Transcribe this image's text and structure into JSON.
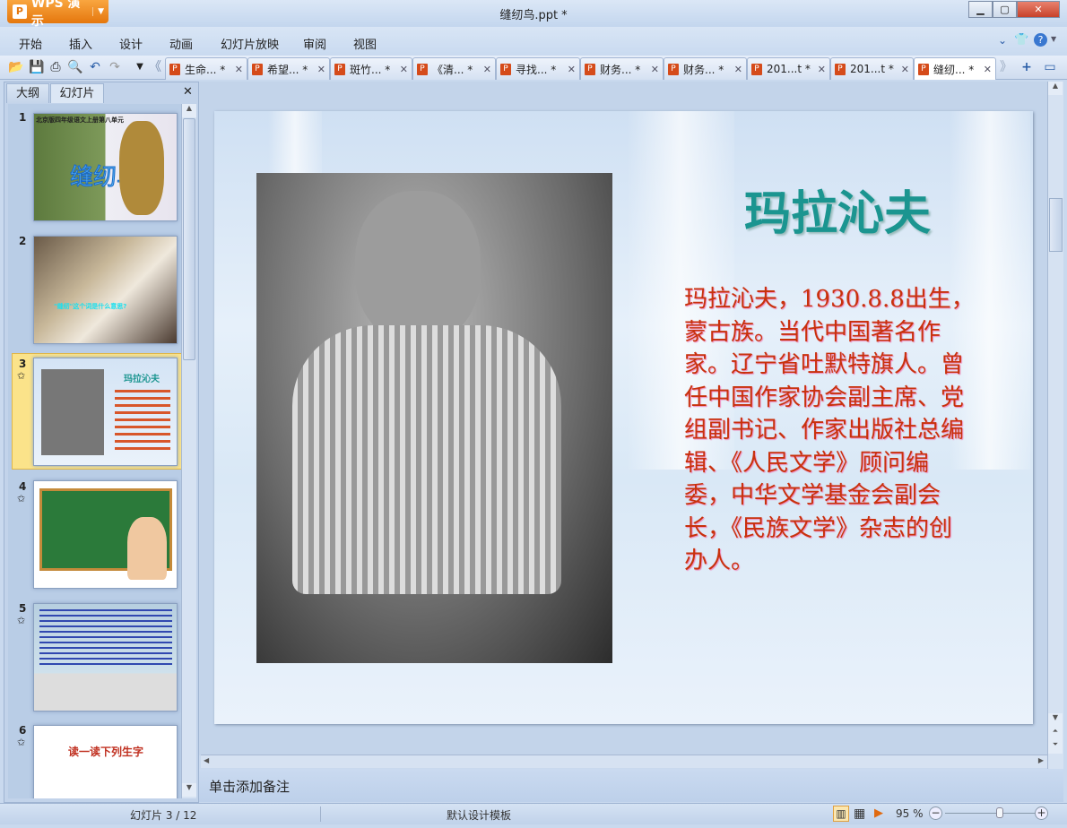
{
  "app": {
    "name": "WPS 演示",
    "document_title": "缝纫鸟.ppt *"
  },
  "menu": [
    "开始",
    "插入",
    "设计",
    "动画",
    "幻灯片放映",
    "审阅",
    "视图"
  ],
  "doc_tabs": [
    {
      "label": "生命... *",
      "active": false
    },
    {
      "label": "希望... *",
      "active": false
    },
    {
      "label": "斑竹... *",
      "active": false
    },
    {
      "label": "《清... *",
      "active": false
    },
    {
      "label": "寻找... *",
      "active": false
    },
    {
      "label": "财务... *",
      "active": false
    },
    {
      "label": "财务... *",
      "active": false
    },
    {
      "label": "201...t *",
      "active": false
    },
    {
      "label": "201...t *",
      "active": false
    },
    {
      "label": "缝纫... *",
      "active": true
    }
  ],
  "panel": {
    "tabs": [
      "大纲",
      "幻灯片"
    ],
    "active_tab": "幻灯片"
  },
  "thumbnails": [
    {
      "num": "1",
      "texts": [
        "北京版四年级语文上册第八单元",
        "缝纫鸟"
      ]
    },
    {
      "num": "2",
      "texts": [
        "\"缝纫\"这个词是什么意思?"
      ]
    },
    {
      "num": "3",
      "texts": [
        "玛拉沁夫"
      ],
      "selected": true
    },
    {
      "num": "4",
      "texts": []
    },
    {
      "num": "5",
      "texts": []
    },
    {
      "num": "6",
      "texts": [
        "读一读下列生字"
      ]
    }
  ],
  "slide": {
    "title": "玛拉沁夫",
    "body": "玛拉沁夫，1930.8.8出生，　蒙古族。当代中国著名作家。辽宁省吐默特旗人。曾任中国作家协会副主席、党组副书记、作家出版社总编辑、《人民文学》顾问编委，中华文学基金会副会长，《民族文学》杂志的创办人。",
    "title_color": "#1b9590",
    "body_color": "#c8310c"
  },
  "notes_placeholder": "单击添加备注",
  "status": {
    "slide_position": "幻灯片 3 / 12",
    "template": "默认设计模板",
    "zoom": "95 %",
    "zoom_percent": 95
  }
}
